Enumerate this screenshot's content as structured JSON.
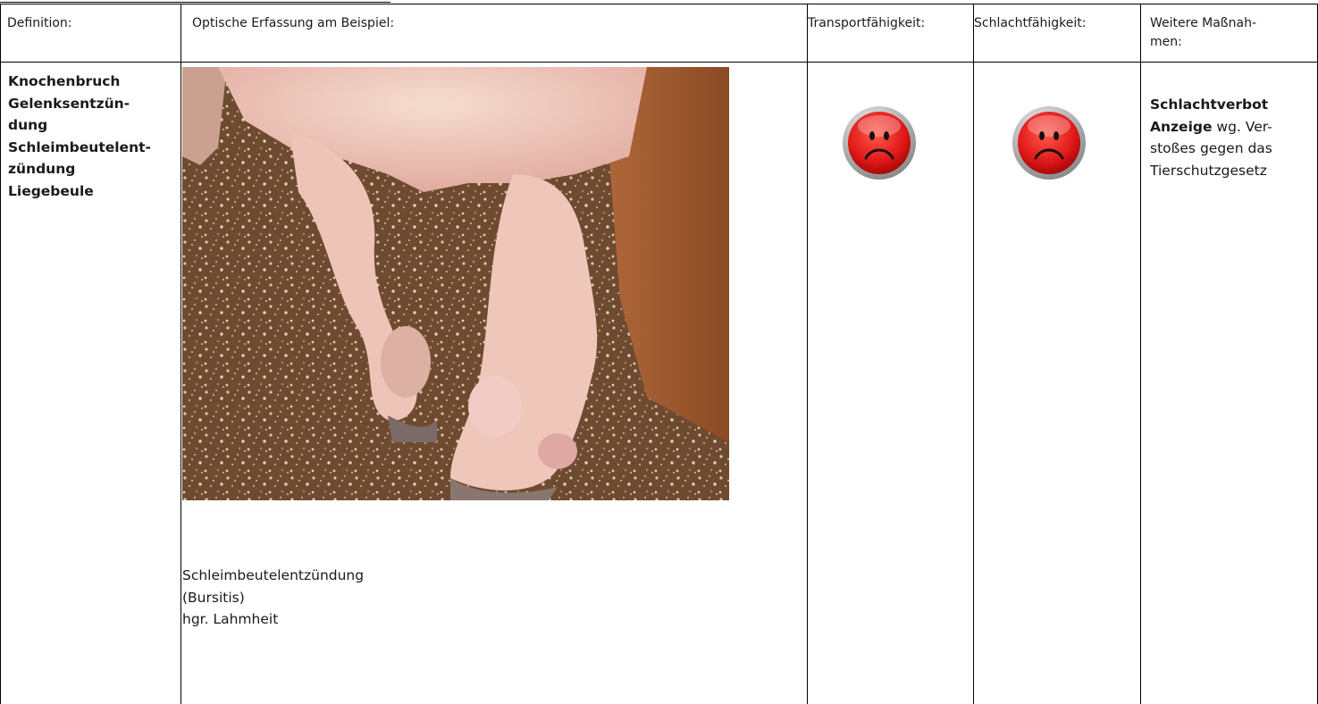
{
  "table": {
    "headers": {
      "definition": "Definition:",
      "optical": "Optische Erfassung am Beispiel:",
      "transport": "Transportfähigkeit:",
      "slaughter": "Schlachtfähigkeit:",
      "further_line1": "Weitere Maßnah-",
      "further_line2": "men:"
    },
    "row": {
      "definition_lines": [
        "Knochenbruch",
        "Gelenksentzün-",
        "dung",
        "Schleimbeutelent-",
        "zündung",
        "Liegebeule"
      ],
      "caption_lines": [
        "Schleimbeutelentzündung",
        "(Bursitis)",
        "hgr. Lahmheit"
      ],
      "transport_icon": "sad-face-icon",
      "slaughter_icon": "sad-face-icon",
      "measures": {
        "line1": "Schlachtverbot",
        "line2_bold": "Anzeige",
        "line2_rest": " wg. Ver-",
        "line3": "stoßes gegen das",
        "line4": "Tierschutzgesetz"
      }
    }
  },
  "colors": {
    "smiley_red": "#e01818",
    "smiley_rim": "#b8b8b8"
  }
}
